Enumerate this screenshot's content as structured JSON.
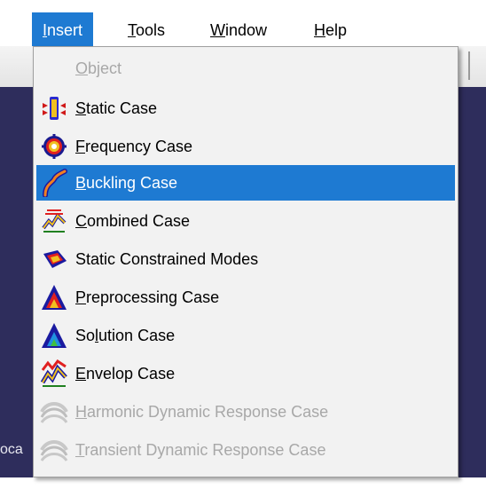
{
  "menubar": {
    "items": [
      {
        "label": "Insert",
        "mnemonic": "I",
        "rest": "nsert",
        "active": true
      },
      {
        "label": "Tools",
        "mnemonic": "T",
        "rest": "ools"
      },
      {
        "label": "Window",
        "mnemonic": "W",
        "rest": "indow"
      },
      {
        "label": "Help",
        "mnemonic": "H",
        "rest": "elp"
      }
    ]
  },
  "background": {
    "left_text": "oca"
  },
  "insert_menu": {
    "items": [
      {
        "label": "Object",
        "mnemonic": "O",
        "rest": "bject",
        "icon": "none",
        "enabled": false
      },
      {
        "label": "Static Case",
        "mnemonic": "S",
        "rest": "tatic Case",
        "icon": "static-case-icon",
        "enabled": true
      },
      {
        "label": "Frequency Case",
        "mnemonic": "F",
        "rest": "requency Case",
        "icon": "frequency-case-icon",
        "enabled": true
      },
      {
        "label": "Buckling Case",
        "mnemonic": "B",
        "rest": "uckling Case",
        "icon": "buckling-case-icon",
        "enabled": true,
        "highlighted": true
      },
      {
        "label": "Combined Case",
        "mnemonic": "C",
        "rest": "ombined Case",
        "icon": "combined-case-icon",
        "enabled": true
      },
      {
        "label": "Static Constrained Modes",
        "pre": "Static Constrained Modes",
        "icon": "static-constrained-modes-icon",
        "enabled": true
      },
      {
        "label": "Preprocessing Case",
        "mnemonic": "P",
        "rest": "reprocessing Case",
        "icon": "preprocessing-case-icon",
        "enabled": true
      },
      {
        "label": "Solution Case",
        "pre": "So",
        "mnemonic": "l",
        "rest": "ution Case",
        "icon": "solution-case-icon",
        "enabled": true
      },
      {
        "label": "Envelop Case",
        "mnemonic": "E",
        "rest": "nvelop Case",
        "icon": "envelop-case-icon",
        "enabled": true
      },
      {
        "label": "Harmonic Dynamic Response Case",
        "mnemonic": "H",
        "rest": "armonic Dynamic Response Case",
        "icon": "harmonic-dynamic-response-icon",
        "enabled": false
      },
      {
        "label": "Transient Dynamic Response Case",
        "mnemonic": "T",
        "rest": "ransient Dynamic Response Case",
        "icon": "transient-dynamic-response-icon",
        "enabled": false
      }
    ]
  },
  "colors": {
    "highlight": "#1e7ad2",
    "menu_bg": "#f2f2f2",
    "app_bg": "#2e2d5c",
    "disabled_text": "#a8a8a8"
  }
}
